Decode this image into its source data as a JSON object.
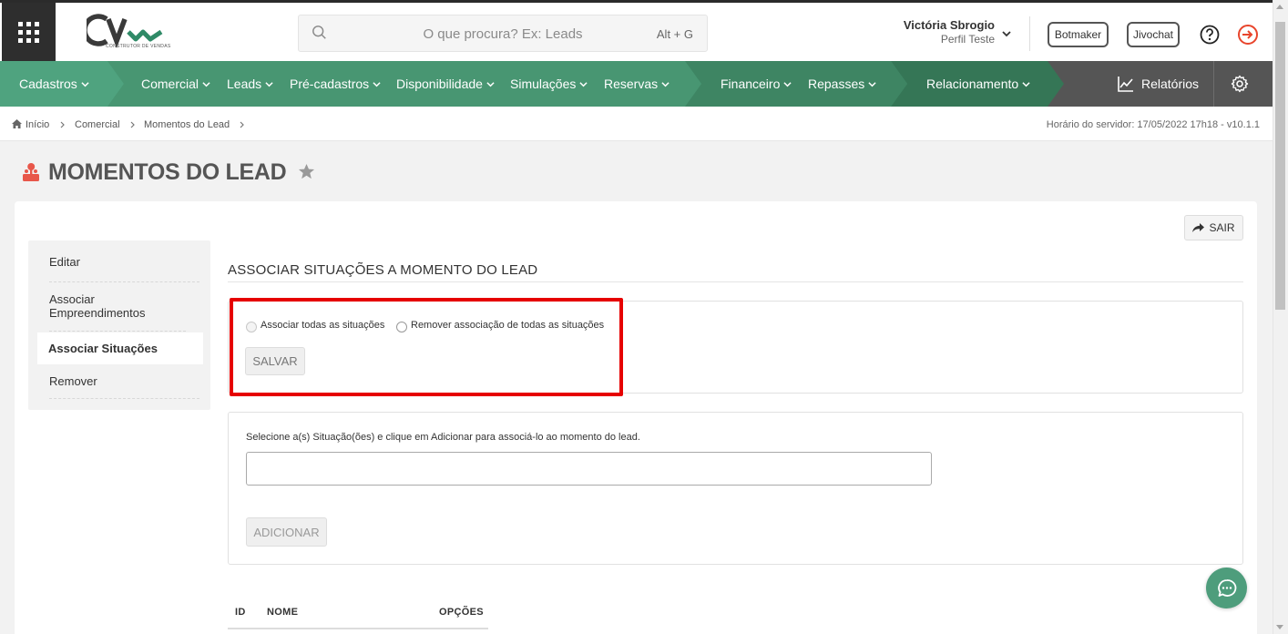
{
  "header": {
    "logo_subtitle": "CONSTRUTOR DE VENDAS",
    "search": {
      "placeholder": "O que procura? Ex: Leads",
      "shortcut": "Alt + G"
    },
    "user": {
      "name": "Victória Sbrogio",
      "profile": "Perfil Teste"
    },
    "buttons": {
      "botmaker": "Botmaker",
      "jivochat": "Jivochat"
    }
  },
  "nav": {
    "items": [
      "Cadastros",
      "Comercial",
      "Leads",
      "Pré-cadastros",
      "Disponibilidade",
      "Simulações",
      "Reservas",
      "Financeiro",
      "Repasses",
      "Relacionamento"
    ],
    "reports": "Relatórios"
  },
  "breadcrumb": {
    "items": [
      "Início",
      "Comercial",
      "Momentos do Lead"
    ],
    "server_time": "Horário do servidor: 17/05/2022 17h18 - v10.1.1"
  },
  "page": {
    "title": "MOMENTOS DO LEAD",
    "exit_label": "SAIR"
  },
  "sidebar": {
    "items": [
      "Editar",
      "Associar Empreendimentos",
      "Associar Situações",
      "Remover"
    ],
    "active": "Associar Situações"
  },
  "section": {
    "title": "ASSOCIAR SITUAÇÕES A MOMENTO DO LEAD",
    "radio_all": "Associar todas as situações",
    "radio_remove": "Remover associação de todas as situações",
    "save": "SALVAR",
    "help": "Selecione a(s) Situação(ões) e clique em Adicionar para associá-lo ao momento do lead.",
    "select_value": "",
    "add": "ADICIONAR"
  },
  "table": {
    "headers": [
      "ID",
      "NOME",
      "OPÇÕES"
    ]
  },
  "colors": {
    "nav_green": "#4e9d7c",
    "nav_dark": "#555555",
    "highlight_red": "#e60000",
    "exit_red": "#e8452c"
  }
}
